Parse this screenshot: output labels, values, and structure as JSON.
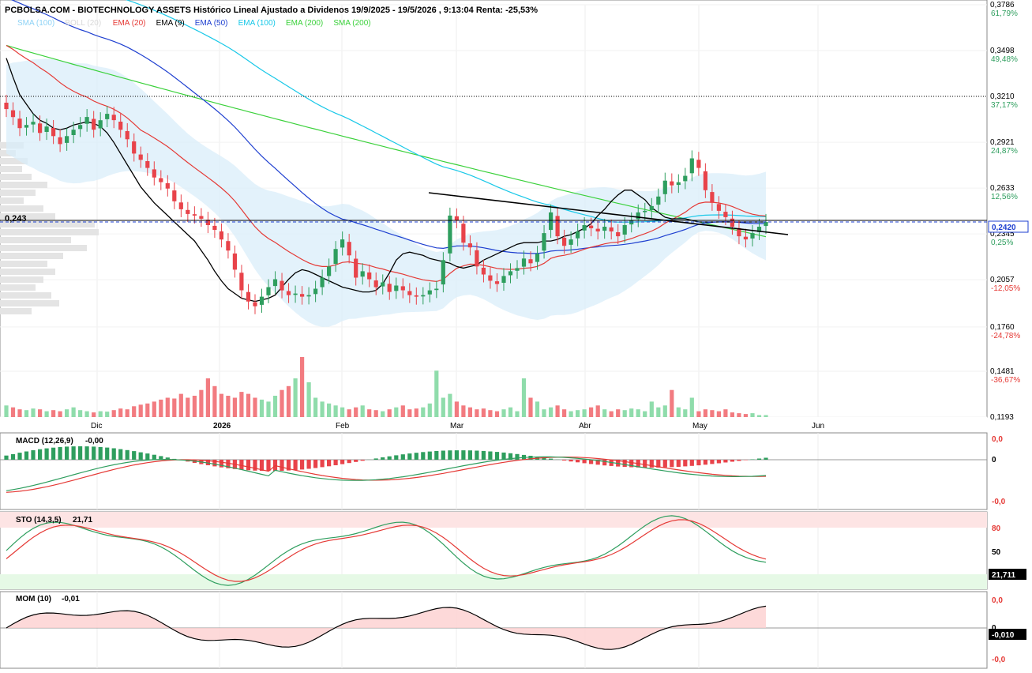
{
  "header": {
    "title": "PCBOLSA.COM - BIOTECHNOLOGY ASSETS Histórico Lineal Ajustado a Dividenos 19/9/2025 - 19/5/2026 , 9:13:04 Renta: -25,53%"
  },
  "legend": [
    {
      "label": "SMA (100)",
      "color": "#8fd3f6"
    },
    {
      "label": "BOLL (20)",
      "color": "#d8d8d8"
    },
    {
      "label": "EMA (20)",
      "color": "#e53935"
    },
    {
      "label": "EMA (9)",
      "color": "#000000"
    },
    {
      "label": "EMA (50)",
      "color": "#1e3fd0"
    },
    {
      "label": "EMA (100)",
      "color": "#18c8e8"
    },
    {
      "label": "EMA (200)",
      "color": "#3bd13b"
    },
    {
      "label": "SMA (200)",
      "color": "#3bd13b"
    }
  ],
  "colors": {
    "up": "#2e9e5e",
    "down": "#e8434a",
    "vol_up": "#8fdcab",
    "vol_down": "#f27b80"
  },
  "price_axis": [
    {
      "price": "0,3786",
      "pct": "61,79%",
      "v": 0.3786
    },
    {
      "price": "0,3498",
      "pct": "49,48%",
      "v": 0.3498
    },
    {
      "price": "0,3210",
      "pct": "37,17%",
      "v": 0.321
    },
    {
      "price": "0,2921",
      "pct": "24,87%",
      "v": 0.2921
    },
    {
      "price": "0,2633",
      "pct": "12,56%",
      "v": 0.2633
    },
    {
      "price": "0,2345",
      "pct": "0,25%",
      "v": 0.2345
    },
    {
      "price": "0,2057",
      "pct": "-12,05%",
      "v": 0.2057
    },
    {
      "price": "0,1760",
      "pct": "-24,78%",
      "v": 0.176
    },
    {
      "price": "0,1481",
      "pct": "-36,67%",
      "v": 0.1481
    },
    {
      "price": "0,1193",
      "pct": "",
      "v": 0.1193
    }
  ],
  "ref_level_label": "0,243",
  "ref_level": 0.243,
  "resistance_level": 0.321,
  "last_price_label": "0,2420",
  "last_price": 0.242,
  "x_axis": [
    "Dic",
    "2026",
    "Feb",
    "Mar",
    "Abr",
    "May",
    "Jun"
  ],
  "macd": {
    "label": "MACD (12,26,9)",
    "value": "-0,00",
    "ticks": [
      "0,0",
      "0",
      "-0,0"
    ]
  },
  "sto": {
    "label": "STO (14,3,5)",
    "value": "21,71",
    "ticks": [
      "80",
      "50",
      "20"
    ],
    "last": "21,711"
  },
  "mom": {
    "label": "MOM (10)",
    "value": "-0,01",
    "ticks": [
      "0,0",
      "0",
      "-0,0"
    ],
    "last": "-0,010"
  },
  "chart_data": {
    "type": "candlestick",
    "title": "PCBOLSA.COM - BIOTECHNOLOGY ASSETS Histórico Lineal Ajustado a Dividenos 19/9/2025 - 19/5/2026",
    "ylim": [
      0.1193,
      0.3786
    ],
    "close": [
      0.313,
      0.308,
      0.301,
      0.303,
      0.305,
      0.298,
      0.302,
      0.296,
      0.291,
      0.296,
      0.3,
      0.303,
      0.308,
      0.3,
      0.306,
      0.31,
      0.306,
      0.3,
      0.294,
      0.285,
      0.281,
      0.276,
      0.27,
      0.267,
      0.263,
      0.255,
      0.25,
      0.247,
      0.246,
      0.244,
      0.24,
      0.237,
      0.231,
      0.224,
      0.212,
      0.199,
      0.192,
      0.189,
      0.195,
      0.201,
      0.206,
      0.199,
      0.196,
      0.197,
      0.195,
      0.196,
      0.2,
      0.207,
      0.214,
      0.225,
      0.231,
      0.221,
      0.207,
      0.211,
      0.206,
      0.201,
      0.204,
      0.198,
      0.202,
      0.199,
      0.196,
      0.195,
      0.196,
      0.199,
      0.2,
      0.218,
      0.246,
      0.243,
      0.229,
      0.226,
      0.214,
      0.209,
      0.205,
      0.203,
      0.208,
      0.211,
      0.213,
      0.219,
      0.216,
      0.222,
      0.235,
      0.248,
      0.233,
      0.227,
      0.231,
      0.236,
      0.24,
      0.238,
      0.236,
      0.239,
      0.236,
      0.233,
      0.24,
      0.243,
      0.248,
      0.249,
      0.252,
      0.258,
      0.268,
      0.265,
      0.267,
      0.271,
      0.282,
      0.276,
      0.262,
      0.254,
      0.249,
      0.245,
      0.239,
      0.233,
      0.231,
      0.235,
      0.239,
      0.242
    ],
    "volume": [
      30,
      25,
      20,
      18,
      22,
      20,
      15,
      18,
      15,
      20,
      25,
      18,
      15,
      12,
      15,
      14,
      18,
      22,
      20,
      28,
      32,
      35,
      40,
      45,
      50,
      48,
      60,
      50,
      55,
      70,
      100,
      80,
      60,
      55,
      50,
      65,
      60,
      50,
      45,
      40,
      55,
      70,
      80,
      100,
      155,
      90,
      50,
      40,
      35,
      30,
      25,
      20,
      25,
      30,
      20,
      18,
      15,
      20,
      25,
      30,
      20,
      22,
      25,
      35,
      120,
      50,
      60,
      40,
      30,
      25,
      20,
      22,
      18,
      15,
      20,
      25,
      15,
      100,
      50,
      40,
      20,
      25,
      30,
      20,
      15,
      18,
      20,
      25,
      30,
      20,
      15,
      20,
      18,
      22,
      20,
      15,
      40,
      25,
      30,
      70,
      25,
      20,
      50,
      15,
      20,
      18,
      15,
      20,
      12,
      10,
      8,
      10,
      5,
      5
    ],
    "ema9": [
      0.345,
      0.333,
      0.322,
      0.316,
      0.31,
      0.306,
      0.304,
      0.301,
      0.3,
      0.301,
      0.303,
      0.304,
      0.305,
      0.304,
      0.302,
      0.298,
      0.292,
      0.285,
      0.278,
      0.271,
      0.264,
      0.259,
      0.254,
      0.25,
      0.246,
      0.242,
      0.238,
      0.234,
      0.23,
      0.224,
      0.218,
      0.211,
      0.205,
      0.2,
      0.197,
      0.194,
      0.193,
      0.192,
      0.193,
      0.194,
      0.196,
      0.201,
      0.206,
      0.21,
      0.212,
      0.211,
      0.209,
      0.207,
      0.205,
      0.203,
      0.201,
      0.2,
      0.199,
      0.198,
      0.198,
      0.199,
      0.203,
      0.21,
      0.218,
      0.222,
      0.223,
      0.222,
      0.221,
      0.219,
      0.218,
      0.217,
      0.216,
      0.214,
      0.213,
      0.214,
      0.215,
      0.218,
      0.22,
      0.222,
      0.224,
      0.226,
      0.228,
      0.229,
      0.229,
      0.229,
      0.23,
      0.23,
      0.231,
      0.233,
      0.234,
      0.236,
      0.238,
      0.241,
      0.246,
      0.25,
      0.255,
      0.259,
      0.262,
      0.262,
      0.259,
      0.256,
      0.251,
      0.248,
      0.245,
      0.244,
      0.244,
      0.244,
      0.243,
      0.242,
      0.242,
      0.242,
      0.242,
      0.242,
      0.242,
      0.242,
      0.242,
      0.242,
      0.242,
      0.242
    ]
  }
}
